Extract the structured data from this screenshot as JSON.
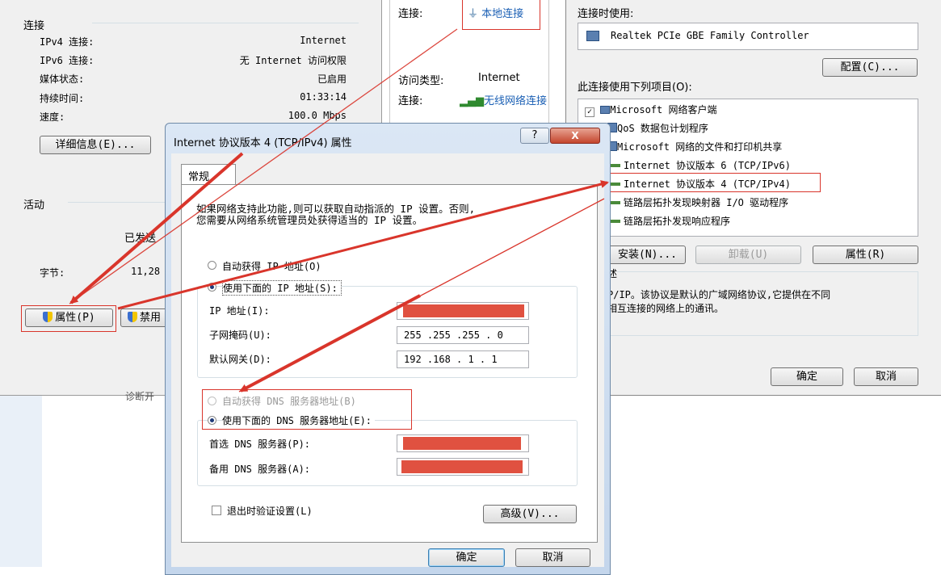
{
  "status_window": {
    "section_connection": "连接",
    "rows": [
      {
        "label": "IPv4 连接:",
        "value": "Internet"
      },
      {
        "label": "IPv6 连接:",
        "value": "无 Internet 访问权限"
      },
      {
        "label": "媒体状态:",
        "value": "已启用"
      },
      {
        "label": "持续时间:",
        "value": "01:33:14"
      },
      {
        "label": "速度:",
        "value": "100.0 Mbps"
      }
    ],
    "details_button": "详细信息(E)...",
    "section_activity": "活动",
    "sent_label": "已发送",
    "bytes_label": "字节:",
    "bytes_value": "11,28",
    "properties_button": "属性(P)",
    "disable_button": "禁用",
    "diagnose_partial": "诊断开"
  },
  "network_window": {
    "conn_label": "连接:",
    "conn_value": "本地连接",
    "access_label": "访问类型:",
    "access_value": "Internet",
    "conn2_label": "连接:",
    "conn2_value": "无线网络连接"
  },
  "props_window": {
    "connect_using_label": "连接时使用:",
    "adapter_name": "Realtek PCIe GBE Family Controller",
    "configure_button": "配置(C)...",
    "items_label": "此连接使用下列项目(O):",
    "items": [
      "Microsoft 网络客户端",
      "QoS 数据包计划程序",
      "Microsoft 网络的文件和打印机共享",
      "Internet 协议版本 6 (TCP/IPv6)",
      "Internet 协议版本 4 (TCP/IPv4)",
      "链路层拓扑发现映射器 I/O 驱动程序",
      "链路层拓扑发现响应程序"
    ],
    "install_button": "安装(N)...",
    "uninstall_button": "卸载(U)",
    "properties_button": "属性(R)",
    "desc_heading": "述",
    "desc_line1": "P/IP。该协议是默认的广域网络协议,它提供在不同",
    "desc_line2": "相互连接的网络上的通讯。",
    "ok_button": "确定",
    "cancel_button": "取消"
  },
  "ipv4_dialog": {
    "title": "Internet 协议版本 4 (TCP/IPv4) 属性",
    "help_button": "?",
    "close_button": "X",
    "tab_general": "常规",
    "intro_line1": "如果网络支持此功能,则可以获取自动指派的 IP 设置。否则,",
    "intro_line2": "您需要从网络系统管理员处获得适当的 IP 设置。",
    "auto_ip": "自动获得 IP 地址(O)",
    "manual_ip": "使用下面的 IP 地址(S):",
    "ip_label": "IP 地址(I):",
    "mask_label": "子网掩码(U):",
    "mask_value": "255 .255 .255 . 0",
    "gateway_label": "默认网关(D):",
    "gateway_value": "192 .168 . 1  . 1",
    "auto_dns": "自动获得 DNS 服务器地址(B)",
    "manual_dns": "使用下面的 DNS 服务器地址(E):",
    "dns1_label": "首选 DNS 服务器(P):",
    "dns2_label": "备用 DNS 服务器(A):",
    "validate_label": "退出时验证设置(L)",
    "advanced_button": "高级(V)...",
    "ok_button": "确定",
    "cancel_button": "取消"
  },
  "colors": {
    "annotation_red": "#d9352b",
    "redaction": "#e05140",
    "title_blue": "#1e3a78"
  }
}
